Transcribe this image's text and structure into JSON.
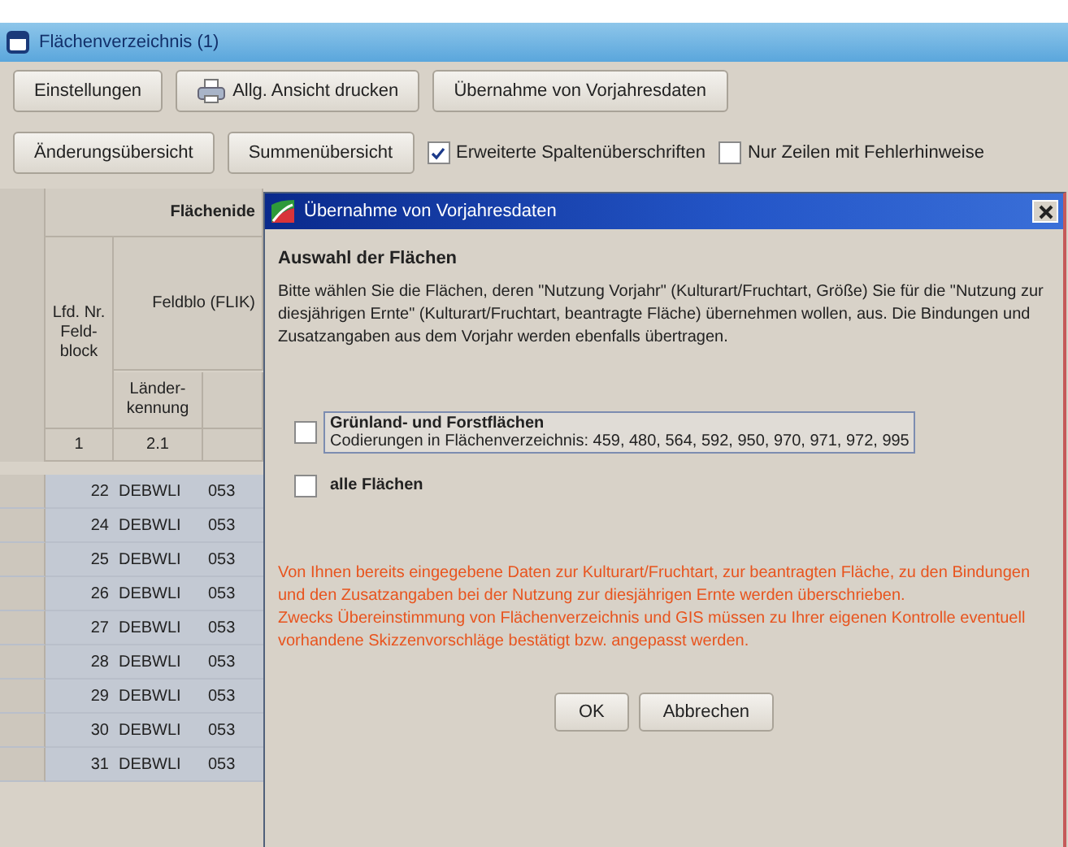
{
  "window": {
    "title": "Flächenverzeichnis (1)"
  },
  "toolbar_1": [
    {
      "label": "Einstellungen",
      "kind": "button"
    },
    {
      "label": "Allg. Ansicht drucken",
      "kind": "print"
    },
    {
      "label": "Übernahme von Vorjahresdaten",
      "kind": "button"
    }
  ],
  "toolbar_2": {
    "buttons": [
      "Änderungsübersicht",
      "Summenübersicht"
    ],
    "options": [
      {
        "label": "Erweiterte Spaltenüberschriften",
        "checked": true
      },
      {
        "label": "Nur Zeilen mit Fehlerhinweise",
        "checked": false
      }
    ]
  },
  "table": {
    "group_header": "Flächenide",
    "columns": [
      {
        "label": "Lfd. Nr. Feld-block",
        "index": "1"
      },
      {
        "label": "Feldblo (FLIK)",
        "sub": "Länder-kennung",
        "index": "2.1"
      }
    ],
    "rows": [
      {
        "nr": "22",
        "land": "DEBWLI",
        "column_3": "053",
        "selected": true
      },
      {
        "nr": "24",
        "land": "DEBWLI",
        "column_3": "053",
        "selected": true
      },
      {
        "nr": "25",
        "land": "DEBWLI",
        "column_3": "053",
        "selected": true
      },
      {
        "nr": "26",
        "land": "DEBWLI",
        "column_3": "053",
        "selected": true
      },
      {
        "nr": "27",
        "land": "DEBWLI",
        "column_3": "053",
        "selected": true
      },
      {
        "nr": "28",
        "land": "DEBWLI",
        "column_3": "053",
        "selected": true
      },
      {
        "nr": "29",
        "land": "DEBWLI",
        "column_3": "053",
        "selected": true
      },
      {
        "nr": "30",
        "land": "DEBWLI",
        "column_3": "053",
        "selected": true
      },
      {
        "nr": "31",
        "land": "DEBWLI",
        "column_3": "053",
        "selected": true
      }
    ]
  },
  "dialog": {
    "title": "Übernahme von Vorjahresdaten",
    "heading": "Auswahl der Flächen",
    "text": "Bitte wählen Sie die Flächen, deren \"Nutzung Vorjahr\" (Kulturart/Fruchtart, Größe) Sie für die \"Nutzung zur diesjährigen Ernte\" (Kulturart/Fruchtart, beantragte Fläche) übernehmen wollen, aus. Die Bindungen und Zusatzangaben aus dem Vorjahr werden ebenfalls übertragen.",
    "options": [
      {
        "label": "Grünland- und Forstflächen",
        "detail": "Codierungen in Flächenverzeichnis: 459, 480, 564, 592, 950, 970, 971, 972, 995",
        "checked": false,
        "focused": true
      },
      {
        "label": "alle Flächen",
        "checked": false,
        "focused": false
      }
    ],
    "warnings": [
      "Von Ihnen bereits eingegebene Daten zur Kulturart/Fruchtart, zur beantragten Fläche, zu den Bindungen und den Zusatzangaben bei der Nutzung zur diesjährigen Ernte werden überschrieben.",
      "Zwecks Übereinstimmung von Flächenverzeichnis und GIS müssen zu Ihrer eigenen Kontrolle eventuell vorhandene Skizzenvorschläge bestätigt bzw. angepasst werden."
    ],
    "buttons": [
      "OK",
      "Abbrechen"
    ]
  }
}
